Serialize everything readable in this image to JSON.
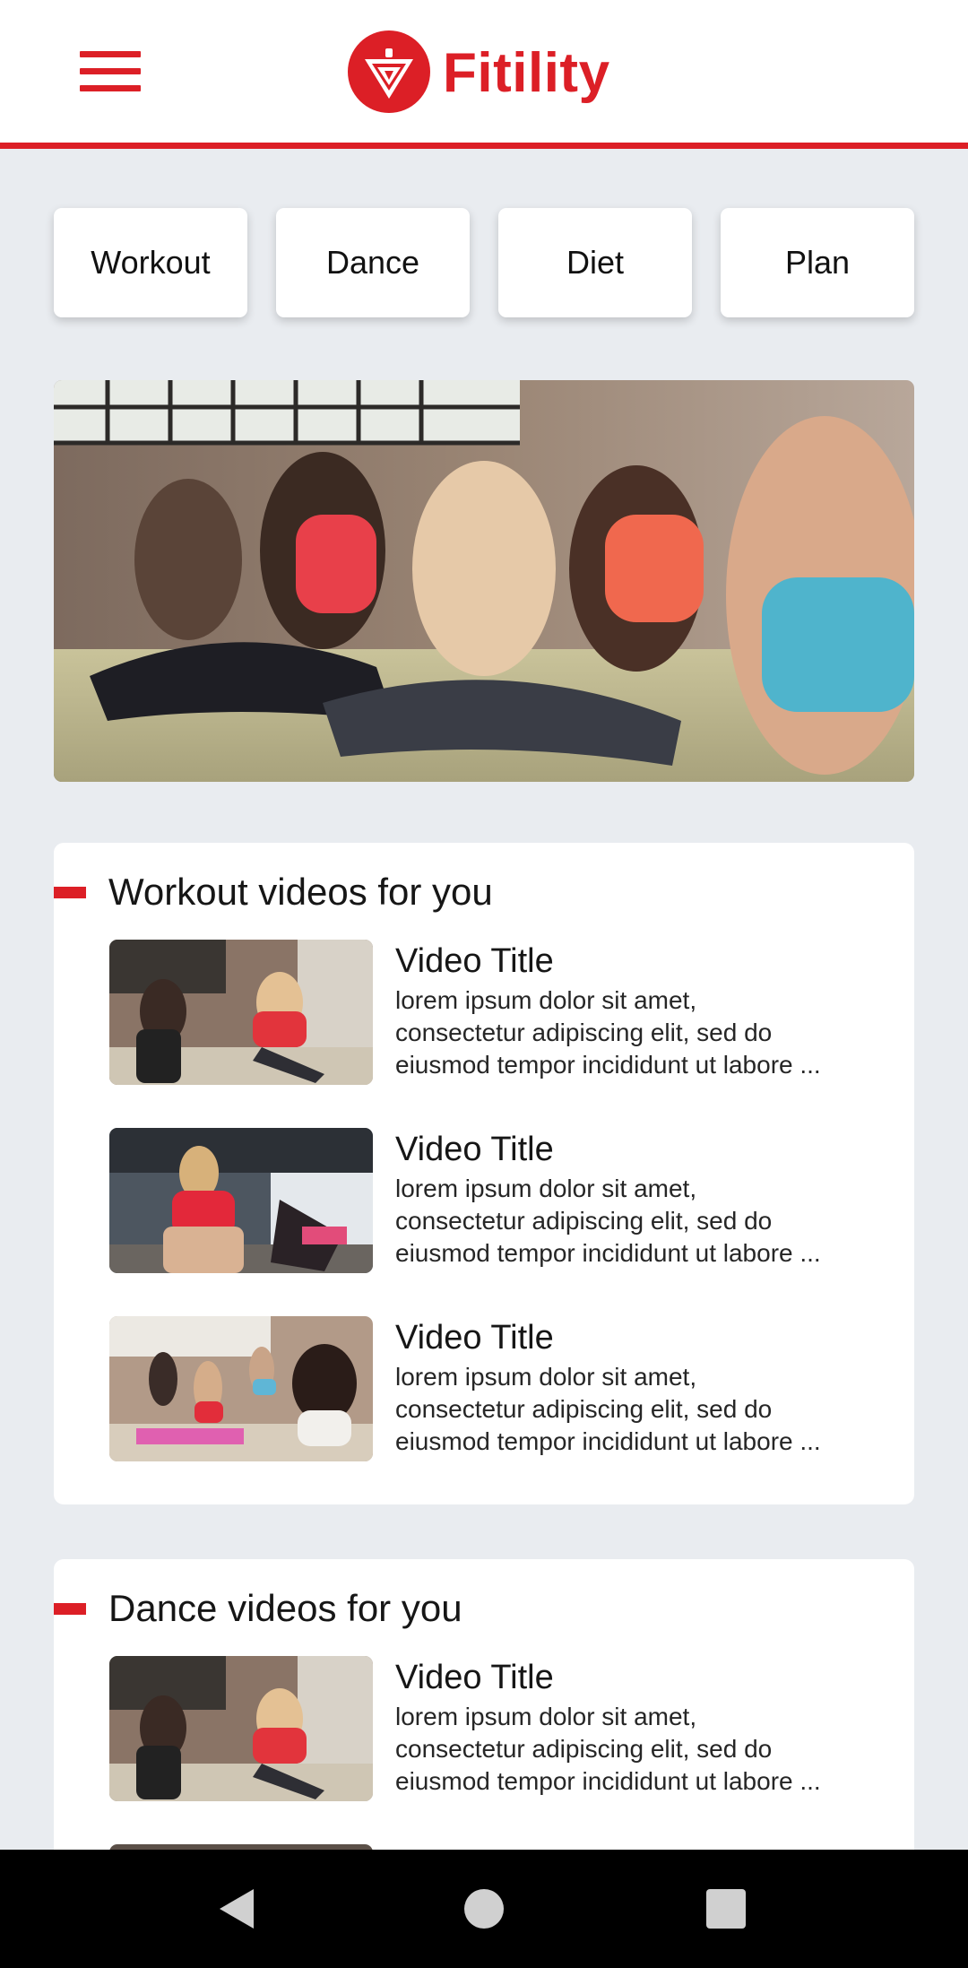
{
  "app": {
    "name": "Fitility",
    "brand_color": "#dc1f26",
    "background": "#e9ecf0"
  },
  "header": {
    "menu_icon": "hamburger-menu-icon",
    "logo_icon": "fitility-logo-icon"
  },
  "tabs": [
    {
      "label": "Workout"
    },
    {
      "label": "Dance"
    },
    {
      "label": "Diet"
    },
    {
      "label": "Plan"
    }
  ],
  "hero": {
    "image": "group-fitness-class-photo"
  },
  "sections": [
    {
      "title": "Workout videos for you",
      "videos": [
        {
          "title": "Video Title",
          "description": "lorem ipsum dolor sit amet,\nconsectetur adipiscing elit, sed do\neiusmod tempor incididunt ut labore ...",
          "thumbnail": "high-five-workout-photo"
        },
        {
          "title": "Video Title",
          "description": "lorem ipsum dolor sit amet,\nconsectetur adipiscing elit, sed do\neiusmod tempor incididunt ut labore ...",
          "thumbnail": "gym-stretch-photo"
        },
        {
          "title": "Video Title",
          "description": "lorem ipsum dolor sit amet,\nconsectetur adipiscing elit, sed do\neiusmod tempor incididunt ut labore ...",
          "thumbnail": "yoga-class-photo"
        }
      ]
    },
    {
      "title": "Dance videos for you",
      "videos": [
        {
          "title": "Video Title",
          "description": "lorem ipsum dolor sit amet,\nconsectetur adipiscing elit, sed do\neiusmod tempor incididunt ut labore ...",
          "thumbnail": "high-five-workout-photo"
        }
      ]
    }
  ],
  "navbar": {
    "back_icon": "back-triangle-icon",
    "home_icon": "home-circle-icon",
    "recents_icon": "recents-square-icon"
  }
}
